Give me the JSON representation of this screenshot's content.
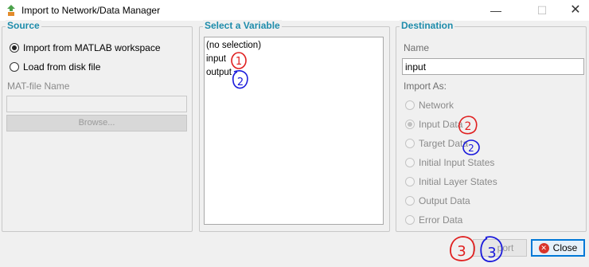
{
  "window": {
    "title": "Import to Network/Data Manager"
  },
  "source": {
    "title": "Source",
    "option_workspace": "Import from MATLAB workspace",
    "option_file": "Load from disk file",
    "mat_label": "MAT-file Name",
    "mat_value": "",
    "browse_label": "Browse..."
  },
  "variable": {
    "title": "Select a Variable",
    "items": [
      "(no selection)",
      "input",
      "output"
    ]
  },
  "destination": {
    "title": "Destination",
    "name_label": "Name",
    "name_value": "input",
    "import_as_label": "Import As:",
    "options": [
      "Network",
      "Input Data",
      "Target Data",
      "Initial Input States",
      "Initial Layer States",
      "Output Data",
      "Error Data"
    ]
  },
  "buttons": {
    "import_label": "port",
    "close_label": "Close"
  },
  "annotations": {
    "n1": "1",
    "n2": "2",
    "n3": "3"
  },
  "colors": {
    "section_title": "#1e8cab",
    "annotation_red": "#e02020",
    "annotation_blue": "#1a1adb"
  }
}
